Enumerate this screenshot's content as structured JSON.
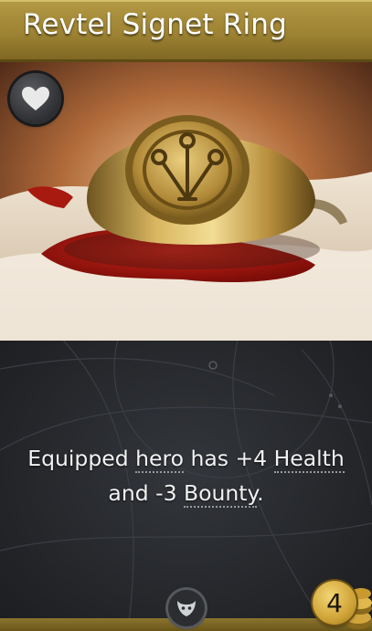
{
  "card": {
    "name": "Revtel Signet Ring",
    "ability": {
      "part1": "Equipped ",
      "kw1": "hero",
      "part2": " has +4 ",
      "kw2": "Health",
      "part3": " and -3 ",
      "kw3": "Bounty",
      "part4": "."
    },
    "gold_cost": "4",
    "icons": {
      "favorite": "heart-icon",
      "card_type": "item-type-icon",
      "cost": "gold-coin-icon"
    }
  },
  "colors": {
    "title_bar": "#9c8232",
    "panel": "#26282c",
    "coin": "#cfa336",
    "wax": "#a5150f",
    "ring": "#c9a24a"
  }
}
